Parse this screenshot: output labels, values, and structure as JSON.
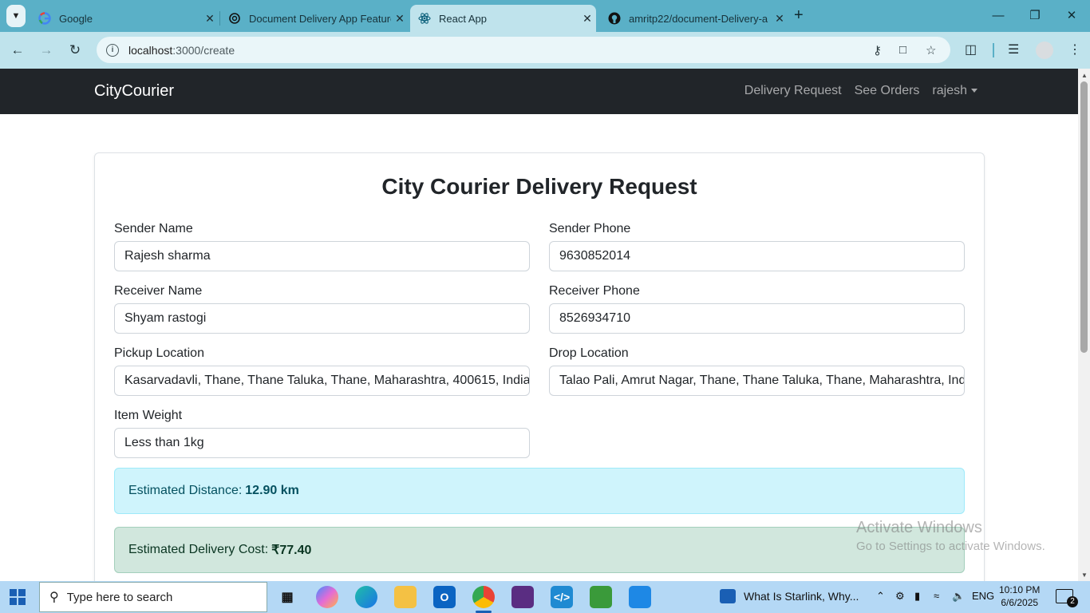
{
  "browser": {
    "tabs": [
      {
        "title": "Google",
        "icon": "google-icon",
        "active": false
      },
      {
        "title": "Document Delivery App Feature",
        "icon": "chatgpt-icon",
        "active": false
      },
      {
        "title": "React App",
        "icon": "react-icon",
        "active": true
      },
      {
        "title": "amritp22/document-Delivery-a",
        "icon": "github-icon",
        "active": false
      }
    ],
    "new_tab_label": "+",
    "url_host": "localhost",
    "url_path": ":3000/create"
  },
  "navbar": {
    "brand": "CityCourier",
    "links": [
      "Delivery Request",
      "See Orders"
    ],
    "user": "rajesh"
  },
  "form": {
    "title": "City Courier Delivery Request",
    "sender_name": {
      "label": "Sender Name",
      "value": "Rajesh sharma"
    },
    "sender_phone": {
      "label": "Sender Phone",
      "value": "9630852014"
    },
    "receiver_name": {
      "label": "Receiver Name",
      "value": "Shyam rastogi"
    },
    "receiver_phone": {
      "label": "Receiver Phone",
      "value": "8526934710"
    },
    "pickup_location": {
      "label": "Pickup Location",
      "value": "Kasarvadavli, Thane, Thane Taluka, Thane, Maharashtra, 400615, India"
    },
    "drop_location": {
      "label": "Drop Location",
      "value": "Talao Pali, Amrut Nagar, Thane, Thane Taluka, Thane, Maharashtra, India"
    },
    "item_weight": {
      "label": "Item Weight",
      "value": "Less than 1kg"
    }
  },
  "estimates": {
    "distance_label": "Estimated Distance:",
    "distance_value": "12.90 km",
    "cost_label": "Estimated Delivery Cost:",
    "cost_value": "₹77.40"
  },
  "watermark": {
    "line1": "Activate Windows",
    "line2": "Go to Settings to activate Windows."
  },
  "taskbar": {
    "search_placeholder": "Type here to search",
    "news": "What Is Starlink, Why...",
    "lang": "ENG",
    "time": "10:10 PM",
    "date": "6/6/2025",
    "notifications": "2"
  },
  "colors": {
    "navbar_bg": "#212529",
    "tabbar_bg": "#5ab0c7",
    "toolbar_bg": "#bfe3ec",
    "info_alert_bg": "#cff4fc",
    "success_alert_bg": "#d1e7dd"
  }
}
